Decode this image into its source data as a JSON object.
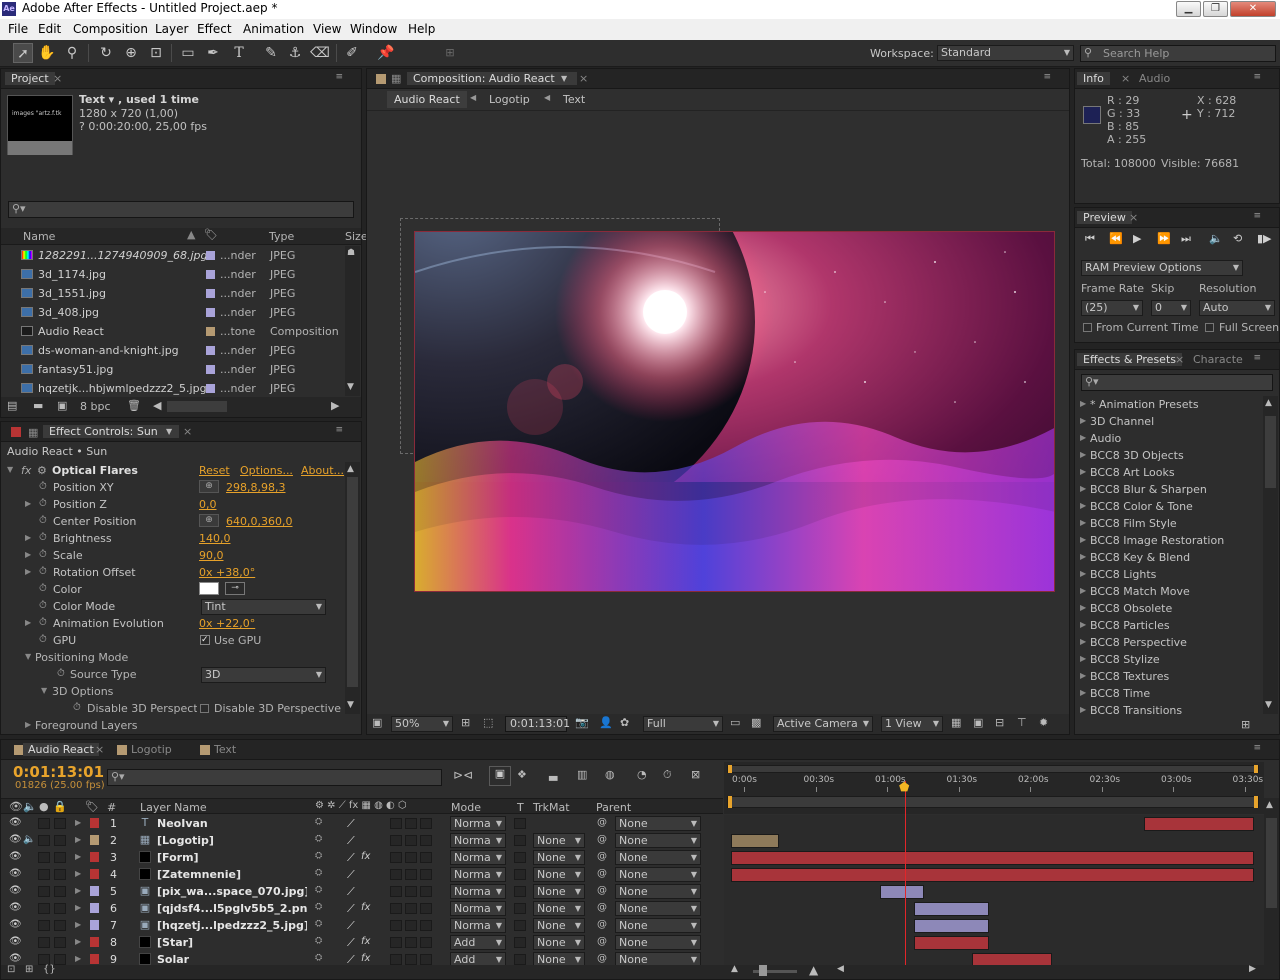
{
  "window": {
    "title": "Adobe After Effects - Untitled Project.aep *",
    "app_icon": "Ae"
  },
  "menu": [
    "File",
    "Edit",
    "Composition",
    "Layer",
    "Effect",
    "Animation",
    "View",
    "Window",
    "Help"
  ],
  "toolbar": {
    "workspace_label": "Workspace:",
    "workspace_value": "Standard",
    "search_placeholder": "Search Help"
  },
  "project": {
    "tab": "Project",
    "thumb_text": "images \"artz.f.tk",
    "item_name": "Text ▾ , used 1 time",
    "item_dims": "1280 x 720 (1,00)",
    "item_duration": "? 0:00:20:00, 25,00 fps",
    "columns": [
      "Name",
      "Type",
      "Size"
    ],
    "files": [
      {
        "name": "1282291...1274940909_68.jpg",
        "label": "...nder",
        "type": "JPEG",
        "label_color": "#a9a3d9",
        "italic": true
      },
      {
        "name": "3d_1174.jpg",
        "label": "...nder",
        "type": "JPEG",
        "label_color": "#a9a3d9"
      },
      {
        "name": "3d_1551.jpg",
        "label": "...nder",
        "type": "JPEG",
        "label_color": "#a9a3d9"
      },
      {
        "name": "3d_408.jpg",
        "label": "...nder",
        "type": "JPEG",
        "label_color": "#a9a3d9"
      },
      {
        "name": "Audio React",
        "label": "...tone",
        "type": "Composition",
        "label_color": "#b59a72"
      },
      {
        "name": "ds-woman-and-knight.jpg",
        "label": "...nder",
        "type": "JPEG",
        "label_color": "#a9a3d9"
      },
      {
        "name": "fantasy51.jpg",
        "label": "...nder",
        "type": "JPEG",
        "label_color": "#a9a3d9"
      },
      {
        "name": "hqzetjk...hbjwmlpedzzz2_5.jpg",
        "label": "...nder",
        "type": "JPEG",
        "label_color": "#a9a3d9"
      }
    ],
    "bpc": "8 bpc"
  },
  "effect_controls": {
    "tab": "Effect Controls: Sun",
    "breadcrumb": "Audio React • Sun",
    "effect_name": "Optical Flares",
    "reset": "Reset",
    "options": "Options...",
    "about": "About...",
    "props": [
      {
        "label": "Position XY",
        "value": "298,8,98,3",
        "expand": false,
        "crosshair": true
      },
      {
        "label": "Position Z",
        "value": "0,0",
        "expand": true
      },
      {
        "label": "Center Position",
        "value": "640,0,360,0",
        "expand": false,
        "crosshair": true
      },
      {
        "label": "Brightness",
        "value": "140,0",
        "expand": true
      },
      {
        "label": "Scale",
        "value": "90,0",
        "expand": true
      },
      {
        "label": "Rotation Offset",
        "value": "0x +38,0°",
        "expand": true
      },
      {
        "label": "Color",
        "value": "",
        "expand": false,
        "color": "#ffffff"
      },
      {
        "label": "Color Mode",
        "value": "Tint",
        "expand": false,
        "dropdown": true
      },
      {
        "label": "Animation Evolution",
        "value": "0x +22,0°",
        "expand": true
      },
      {
        "label": "GPU",
        "value": "Use GPU",
        "expand": false,
        "checkbox": true
      }
    ],
    "positioning_mode": "Positioning Mode",
    "source_type_label": "Source Type",
    "source_type_value": "3D",
    "options_3d": "3D Options",
    "disable_3d_label": "Disable 3D Perspecti",
    "disable_3d_check": "Disable 3D Perspective",
    "foreground_layers": "Foreground Layers"
  },
  "composition": {
    "tab": "Composition: Audio React",
    "breadcrumbs": [
      "Audio React",
      "Logotip",
      "Text"
    ],
    "zoom": "50%",
    "timecode": "0:01:13:01",
    "resolution": "Full",
    "camera": "Active Camera",
    "view": "1 View"
  },
  "info": {
    "tabs": [
      "Info",
      "Audio"
    ],
    "r": "R : 29",
    "g": "G : 33",
    "b": "B : 85",
    "a": "A : 255",
    "x": "X : 628",
    "y": "Y : 712",
    "swatch_color": "#1d2155",
    "total": "Total: 108000",
    "visible": "Visible: 76681"
  },
  "preview": {
    "tab": "Preview",
    "ram_preview": "RAM Preview Options",
    "frame_rate_label": "Frame Rate",
    "frame_rate_value": "(25)",
    "skip_label": "Skip",
    "skip_value": "0",
    "resolution_label": "Resolution",
    "resolution_value": "Auto",
    "from_current": "From Current Time",
    "full_screen": "Full Screen"
  },
  "effects_presets": {
    "tabs": [
      "Effects & Presets",
      "Characte"
    ],
    "items": [
      "* Animation Presets",
      "3D Channel",
      "Audio",
      "BCC8 3D Objects",
      "BCC8 Art Looks",
      "BCC8 Blur & Sharpen",
      "BCC8 Color & Tone",
      "BCC8 Film Style",
      "BCC8 Image Restoration",
      "BCC8 Key & Blend",
      "BCC8 Lights",
      "BCC8 Match Move",
      "BCC8 Obsolete",
      "BCC8 Particles",
      "BCC8 Perspective",
      "BCC8 Stylize",
      "BCC8 Textures",
      "BCC8 Time",
      "BCC8 Transitions"
    ]
  },
  "timeline": {
    "tabs": [
      "Audio React",
      "Logotip",
      "Text"
    ],
    "timecode": "0:01:13:01",
    "frame_info": "01826 (25.00 fps)",
    "headers": {
      "layer_name": "Layer Name",
      "mode": "Mode",
      "t": "T",
      "trkmat": "TrkMat",
      "parent": "Parent"
    },
    "ruler": [
      "0:00s",
      "00:30s",
      "01:00s",
      "01:30s",
      "02:00s",
      "02:30s",
      "03:00s",
      "03:30s"
    ],
    "layers": [
      {
        "num": "1",
        "name": "NeoIvan",
        "mode": "Norma",
        "trkmat": "",
        "parent": "None",
        "label_color": "#b83434",
        "bar_color": "#a8343a",
        "fx": false,
        "icon": "text"
      },
      {
        "num": "2",
        "name": "[Logotip]",
        "mode": "Norma",
        "trkmat": "None",
        "parent": "None",
        "label_color": "#b59a72",
        "bar_color": "#8e7a5a",
        "fx": false,
        "icon": "comp"
      },
      {
        "num": "3",
        "name": "[Form]",
        "mode": "Norma",
        "trkmat": "None",
        "parent": "None",
        "label_color": "#b83434",
        "bar_color": "#a8343a",
        "fx": true,
        "icon": "solid"
      },
      {
        "num": "4",
        "name": "[Zatemnenie]",
        "mode": "Norma",
        "trkmat": "None",
        "parent": "None",
        "label_color": "#b83434",
        "bar_color": "#a8343a",
        "fx": false,
        "icon": "solid"
      },
      {
        "num": "5",
        "name": "[pix_wa...space_070.jpg]",
        "mode": "Norma",
        "trkmat": "None",
        "parent": "None",
        "label_color": "#a9a3d9",
        "bar_color": "#8d88b8",
        "fx": false,
        "icon": "img"
      },
      {
        "num": "6",
        "name": "[qjdsf4...l5pglv5b5_2.png]",
        "mode": "Norma",
        "trkmat": "None",
        "parent": "None",
        "label_color": "#a9a3d9",
        "bar_color": "#8d88b8",
        "fx": true,
        "icon": "png"
      },
      {
        "num": "7",
        "name": "[hqzetj...lpedzzz2_5.jpg]",
        "mode": "Norma",
        "trkmat": "None",
        "parent": "None",
        "label_color": "#a9a3d9",
        "bar_color": "#8d88b8",
        "fx": false,
        "icon": "img"
      },
      {
        "num": "8",
        "name": "[Star]",
        "mode": "Add",
        "trkmat": "None",
        "parent": "None",
        "label_color": "#b83434",
        "bar_color": "#a8343a",
        "fx": true,
        "icon": "solid"
      },
      {
        "num": "9",
        "name": "Solar",
        "mode": "Add",
        "trkmat": "None",
        "parent": "None",
        "label_color": "#b83434",
        "bar_color": "#a8343a",
        "fx": true,
        "icon": "solid"
      }
    ]
  }
}
